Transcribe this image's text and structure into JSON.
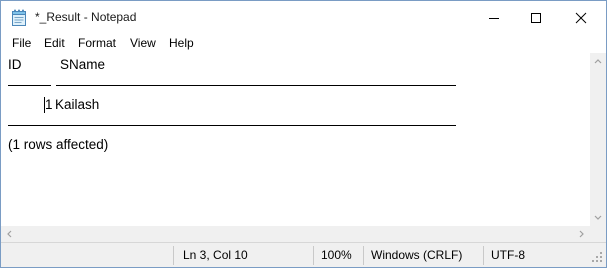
{
  "window": {
    "title": "*_Result - Notepad",
    "icon": "notepad-icon"
  },
  "menu": {
    "file": "File",
    "edit": "Edit",
    "format": "Format",
    "view": "View",
    "help": "Help"
  },
  "editor": {
    "header_id": "ID",
    "header_sname": "SName",
    "row_id": "1",
    "row_name": "Kailash",
    "affected": "(1 rows affected)"
  },
  "status": {
    "position": "Ln 3, Col 10",
    "zoom": "100%",
    "line_ending": "Windows (CRLF)",
    "encoding": "UTF-8"
  },
  "colors": {
    "window_border": "#7a9cc4",
    "statusbar_bg": "#f0f0f0",
    "scrollbar_bg": "#f0f0f0"
  }
}
